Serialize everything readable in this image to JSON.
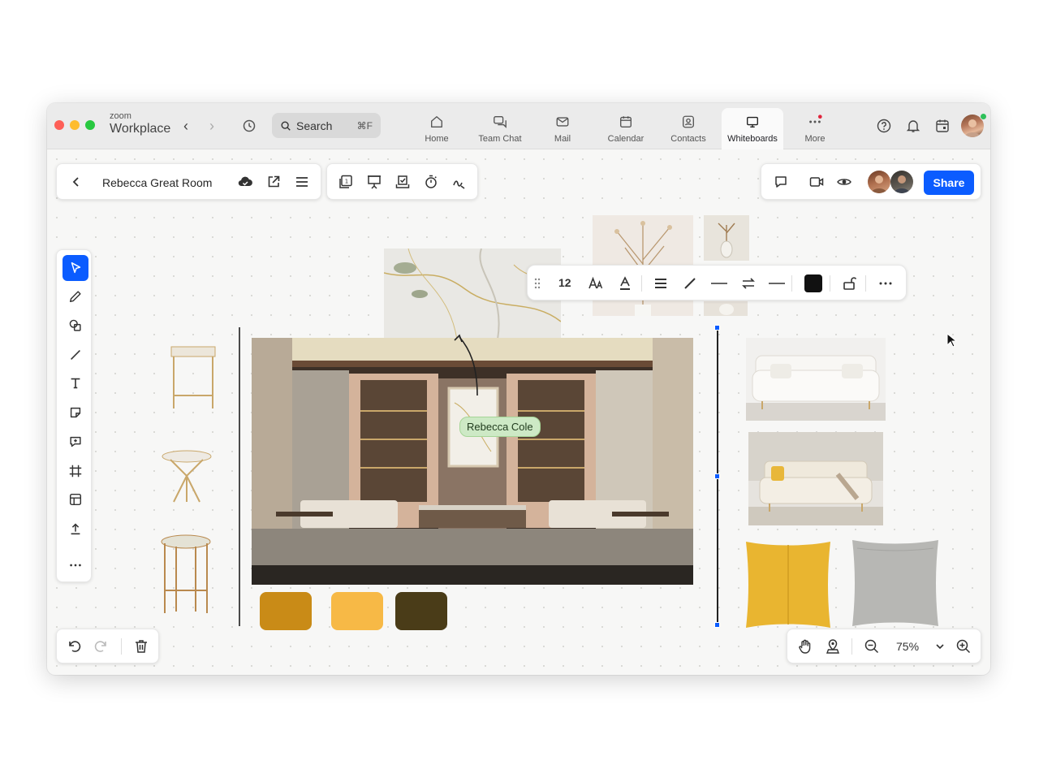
{
  "app": {
    "brand_small": "zoom",
    "brand_big": "Workplace"
  },
  "search": {
    "label": "Search",
    "shortcut": "⌘F"
  },
  "nav_tabs": [
    {
      "label": "Home",
      "icon": "home-icon"
    },
    {
      "label": "Team Chat",
      "icon": "chat-icon"
    },
    {
      "label": "Mail",
      "icon": "mail-icon"
    },
    {
      "label": "Calendar",
      "icon": "calendar-icon"
    },
    {
      "label": "Contacts",
      "icon": "contacts-icon"
    },
    {
      "label": "Whiteboards",
      "icon": "whiteboard-icon",
      "active": true
    },
    {
      "label": "More",
      "icon": "more-icon"
    }
  ],
  "board": {
    "title": "Rebecca Great Room"
  },
  "share": {
    "label": "Share"
  },
  "format_toolbar": {
    "font_size": "12"
  },
  "cursor_label": "Rebecca Cole",
  "zoom": {
    "level": "75%"
  },
  "swatches": [
    "#c98b17",
    "#f7b946",
    "#4a3c18"
  ],
  "colors": {
    "accent": "#0b5cff",
    "red": "#fe5f57",
    "yellow": "#febc2e",
    "green": "#28c840"
  }
}
